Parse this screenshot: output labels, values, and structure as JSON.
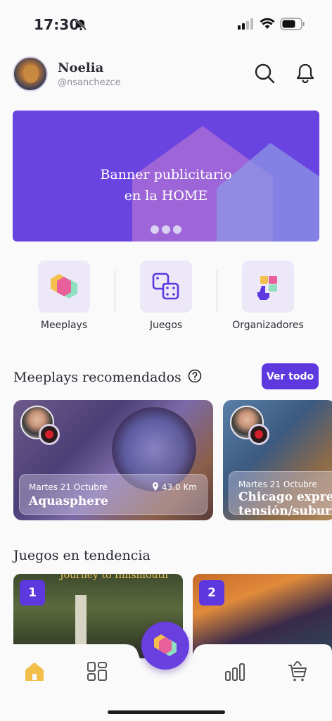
{
  "status_bar": {
    "time": "17:30"
  },
  "user": {
    "name": "Noelia",
    "handle": "@nsanchezce"
  },
  "banner": {
    "line1": "Banner publicitario",
    "line2": "en la HOME"
  },
  "categories": [
    {
      "label": "Meeplays",
      "icon": "meeplays-logo-icon"
    },
    {
      "label": "Juegos",
      "icon": "dice-icon"
    },
    {
      "label": "Organizadores",
      "icon": "organizers-icon"
    }
  ],
  "recommended": {
    "title": "Meeplays recomendados",
    "see_all": "Ver todo",
    "items": [
      {
        "date": "Martes 21 Octubre",
        "distance": "43.0 Km",
        "title": "Aquasphere"
      },
      {
        "date": "Martes 21 Octubre",
        "title_line1": "Chicago express",
        "title_line2": "tensión/suburbi"
      }
    ]
  },
  "trending": {
    "title": "Juegos en tendencia",
    "items": [
      {
        "rank": "1",
        "cover_text": "Journey to Innsmouth"
      },
      {
        "rank": "2"
      }
    ]
  },
  "nav": [
    "home-icon",
    "dashboard-icon",
    "meeplays-fab",
    "stats-icon",
    "basket-icon"
  ],
  "colors": {
    "accent": "#5d38df",
    "home_active": "#f2c04a"
  }
}
